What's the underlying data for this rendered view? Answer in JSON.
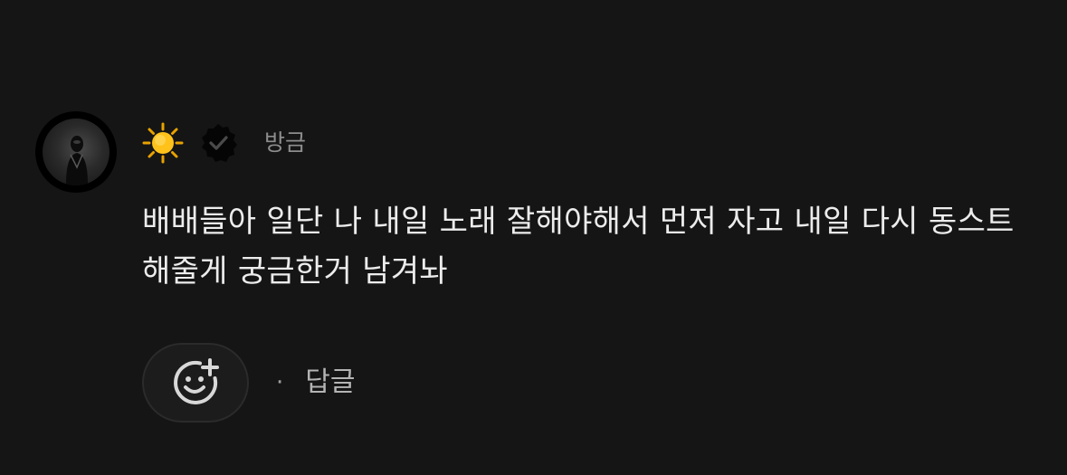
{
  "comment": {
    "username_icon": "sun-emoji",
    "verified_icon": "verified-badge-icon",
    "timestamp": "방금",
    "text": "배배들아 일단 나 내일 노래 잘해야해서 먼저 자고 내일 다시 동스트 해줄게 궁금한거 남겨놔",
    "avatar_icon": "user-avatar"
  },
  "actions": {
    "react_icon": "add-reaction-icon",
    "separator": "·",
    "reply_label": "답글"
  },
  "colors": {
    "background": "#151515",
    "text": "#ececec",
    "muted": "#8d8d8d",
    "sun": "#ffc21a"
  }
}
